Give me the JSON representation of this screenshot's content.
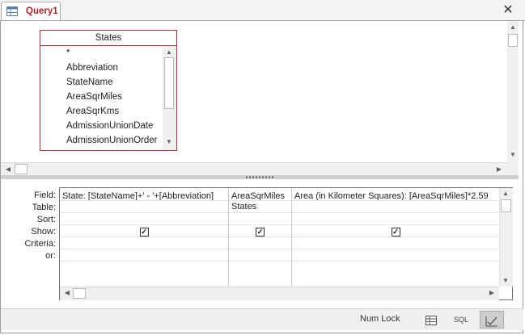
{
  "tab": {
    "title": "Query1",
    "icon": "query-icon"
  },
  "window_controls": {
    "close": "✕"
  },
  "table_box": {
    "title": "States",
    "fields": [
      "*",
      "Abbreviation",
      "StateName",
      "AreaSqrMiles",
      "AreaSqrKms",
      "AdmissionUnionDate",
      "AdmissionUnionOrder"
    ]
  },
  "design_grid": {
    "row_labels": [
      "Field:",
      "Table:",
      "Sort:",
      "Show:",
      "Criteria:",
      "or:"
    ],
    "columns": [
      {
        "field": "State: [StateName]+' - '+[Abbreviation]",
        "table": "",
        "sort": "",
        "show": true
      },
      {
        "field": "AreaSqrMiles",
        "table": "States",
        "sort": "",
        "show": true
      },
      {
        "field": "Area (in Kilometer Squares): [AreaSqrMiles]*2.59",
        "table": "",
        "sort": "",
        "show": true
      }
    ]
  },
  "status_bar": {
    "num_lock": "Num Lock",
    "views": [
      {
        "name": "datasheet-view-icon",
        "label": ""
      },
      {
        "name": "sql-view",
        "label": "SQL"
      },
      {
        "name": "design-view-icon",
        "label": ""
      }
    ],
    "active_view": "design"
  }
}
